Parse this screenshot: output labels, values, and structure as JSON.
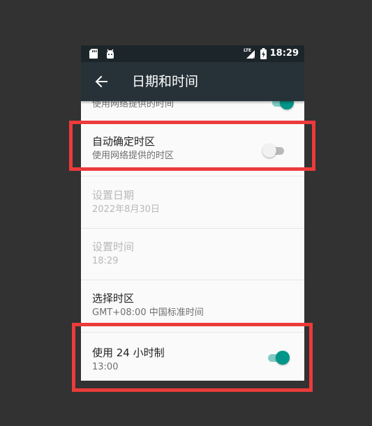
{
  "status_bar": {
    "time": "18:29",
    "network_label": "LTE",
    "icons": [
      "sd-card-icon",
      "android-debug-icon",
      "signal-icon",
      "battery-charging-icon"
    ]
  },
  "toolbar": {
    "back_icon": "arrow-left-icon",
    "title": "日期和时间"
  },
  "settings": {
    "partial": {
      "subtitle": "使用网络提供的时间",
      "switch_on": true
    },
    "auto_timezone": {
      "title": "自动确定时区",
      "subtitle": "使用网络提供的时区",
      "switch_on": false
    },
    "set_date": {
      "title": "设置日期",
      "subtitle": "2022年8月30日",
      "enabled": false
    },
    "set_time": {
      "title": "设置时间",
      "subtitle": "18:29",
      "enabled": false
    },
    "select_timezone": {
      "title": "选择时区",
      "subtitle": "GMT+08:00 中国标准时间"
    },
    "use_24h": {
      "title": "使用 24 小时制",
      "subtitle": "13:00",
      "switch_on": true
    }
  },
  "colors": {
    "statusbar_bg": "#1c2529",
    "toolbar_bg": "#263238",
    "accent": "#009688",
    "accent_track": "#80cbc4",
    "highlight": "#ec3b3b",
    "outer_bg": "#323232"
  }
}
